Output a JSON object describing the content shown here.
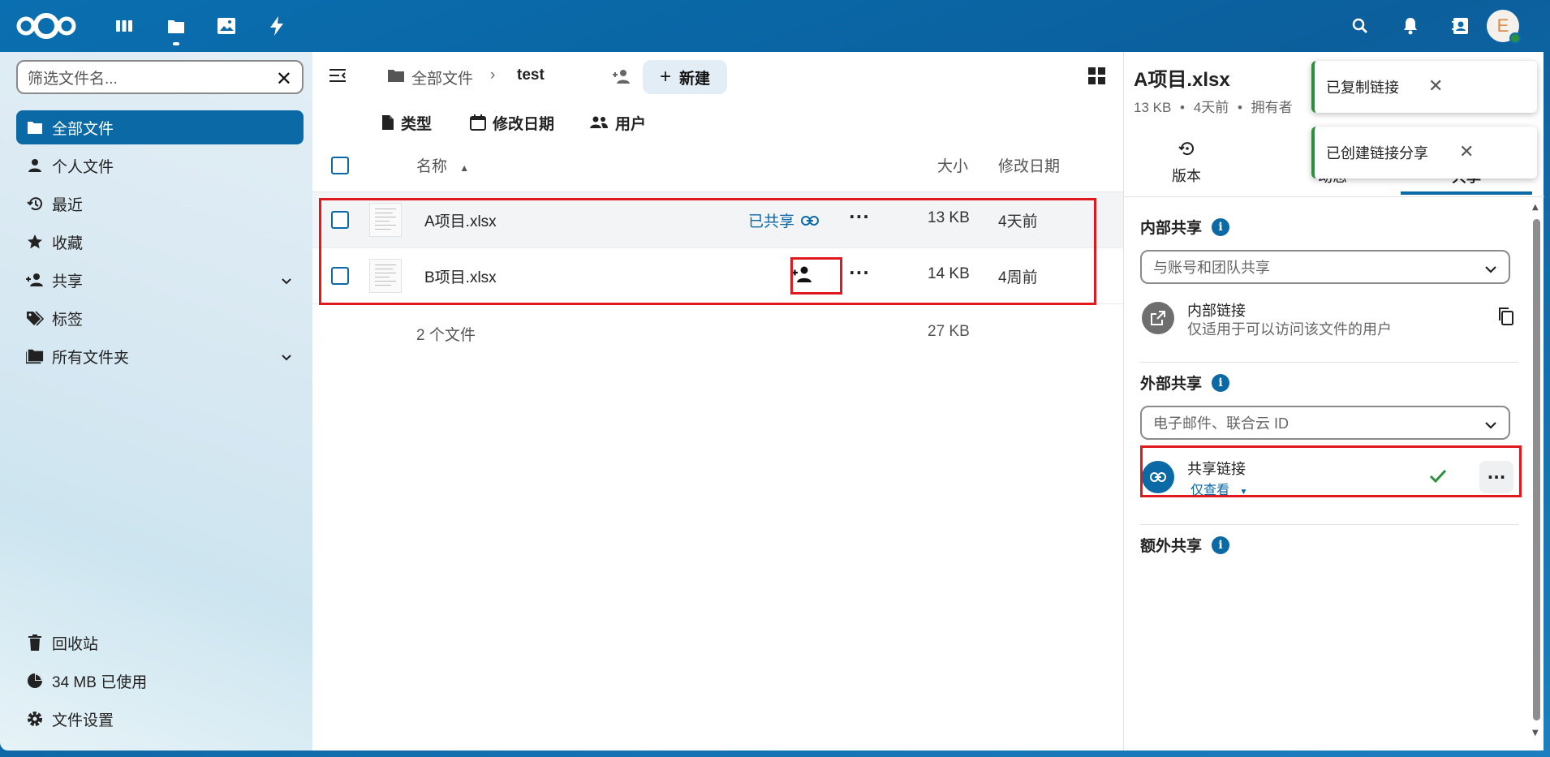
{
  "header": {
    "apps": [
      "dashboard-icon",
      "files-icon",
      "photos-icon",
      "activity-icon"
    ],
    "avatar_letter": "E"
  },
  "leftnav": {
    "filter_placeholder": "筛选文件名...",
    "items": [
      {
        "label": "全部文件",
        "icon": "folder-icon"
      },
      {
        "label": "个人文件",
        "icon": "user-icon"
      },
      {
        "label": "最近",
        "icon": "history-icon"
      },
      {
        "label": "收藏",
        "icon": "star-icon"
      },
      {
        "label": "共享",
        "icon": "share-icon"
      },
      {
        "label": "标签",
        "icon": "tag-icon"
      },
      {
        "label": "所有文件夹",
        "icon": "folders-icon"
      }
    ],
    "footer": [
      {
        "label": "回收站",
        "icon": "trash-icon"
      },
      {
        "label": "34 MB 已使用",
        "icon": "pie-icon"
      },
      {
        "label": "文件设置",
        "icon": "gear-icon"
      }
    ]
  },
  "main": {
    "breadcrumb": {
      "root": "全部文件",
      "current": "test"
    },
    "new_label": "新建",
    "filters": [
      "类型",
      "修改日期",
      "用户"
    ],
    "columns": {
      "name": "名称",
      "size": "大小",
      "modified": "修改日期"
    },
    "files": [
      {
        "name": "A项目.xlsx",
        "shared_label": "已共享",
        "size": "13 KB",
        "modified": "4天前"
      },
      {
        "name": "B项目.xlsx",
        "size": "14 KB",
        "modified": "4周前"
      }
    ],
    "summary": {
      "count": "2 个文件",
      "size": "27 KB"
    }
  },
  "sidebar": {
    "title": "A项目.xlsx",
    "subtitle_parts": [
      "13 KB",
      "4天前",
      "拥有者"
    ],
    "tabs": [
      "版本",
      "动态",
      "共享"
    ],
    "internal": {
      "title": "内部共享",
      "placeholder": "与账号和团队共享",
      "link_title": "内部链接",
      "link_sub": "仅适用于可以访问该文件的用户"
    },
    "external": {
      "title": "外部共享",
      "placeholder": "电子邮件、联合云 ID",
      "link_title": "共享链接",
      "permission": "仅查看"
    },
    "additional": {
      "title": "额外共享"
    }
  },
  "toasts": [
    {
      "text": "已复制链接"
    },
    {
      "text": "已创建链接分享"
    }
  ],
  "colors": {
    "primary": "#0b6aa6",
    "highlight": "#e0191f",
    "success": "#2d8f3e"
  }
}
